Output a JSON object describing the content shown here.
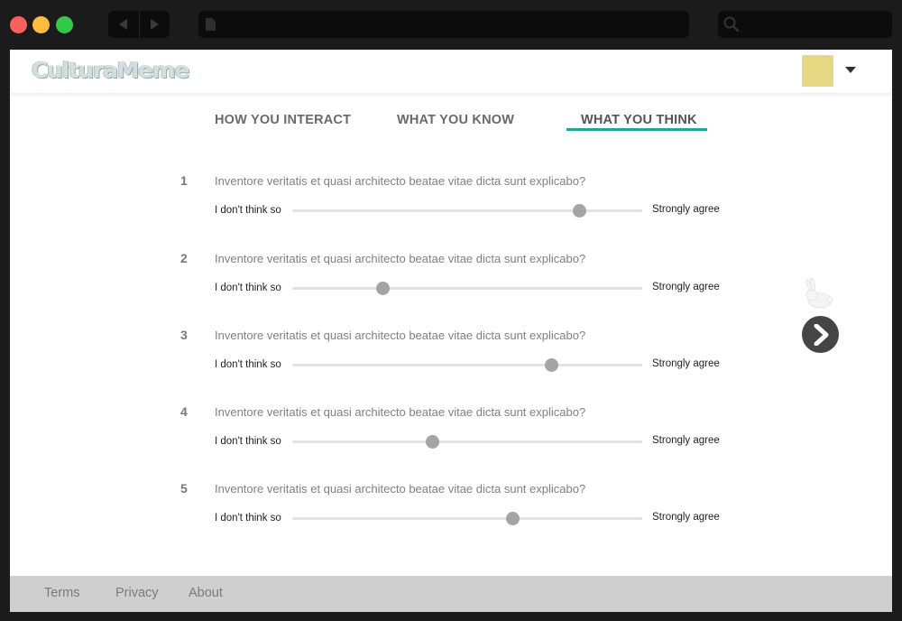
{
  "app": {
    "logo_text": "CulturaMeme"
  },
  "browser": {
    "controls": [
      "close",
      "minimize",
      "maximize"
    ],
    "nav_icons": [
      "back-arrow-icon",
      "forward-arrow-icon"
    ],
    "url_icon": "page-icon",
    "search_icon": "search-icon"
  },
  "header": {
    "avatar_color": "#e6d782",
    "menu_icon": "chevron-down-icon"
  },
  "tabs": [
    {
      "label": "HOW YOU INTERACT",
      "active": false
    },
    {
      "label": "WHAT YOU KNOW",
      "active": false
    },
    {
      "label": "WHAT YOU THINK",
      "active": true
    }
  ],
  "accent_color": "#1aa898",
  "questions": [
    {
      "number": "1",
      "text": "Inventore veritatis et quasi architecto beatae vitae dicta sunt explicabo?",
      "min_label": "I don't think so",
      "max_label": "Strongly agree",
      "value": 0.82
    },
    {
      "number": "2",
      "text": "Inventore veritatis et quasi architecto beatae vitae dicta sunt explicabo?",
      "min_label": "I don't think so",
      "max_label": "Strongly agree",
      "value": 0.26
    },
    {
      "number": "3",
      "text": "Inventore veritatis et quasi architecto beatae vitae dicta sunt explicabo?",
      "min_label": "I don't think so",
      "max_label": "Strongly agree",
      "value": 0.74
    },
    {
      "number": "4",
      "text": "Inventore veritatis et quasi architecto beatae vitae dicta sunt explicabo?",
      "min_label": "I don't think so",
      "max_label": "Strongly agree",
      "value": 0.4
    },
    {
      "number": "5",
      "text": "Inventore veritatis et quasi architecto beatae vitae dicta sunt explicabo?",
      "min_label": "I don't think so",
      "max_label": "Strongly agree",
      "value": 0.63
    }
  ],
  "side": {
    "mascot_icon": "rabbit-icon",
    "next_icon": "chevron-right-icon"
  },
  "footer": {
    "links": [
      {
        "label": "Terms"
      },
      {
        "label": "Privacy"
      },
      {
        "label": "About"
      }
    ]
  }
}
